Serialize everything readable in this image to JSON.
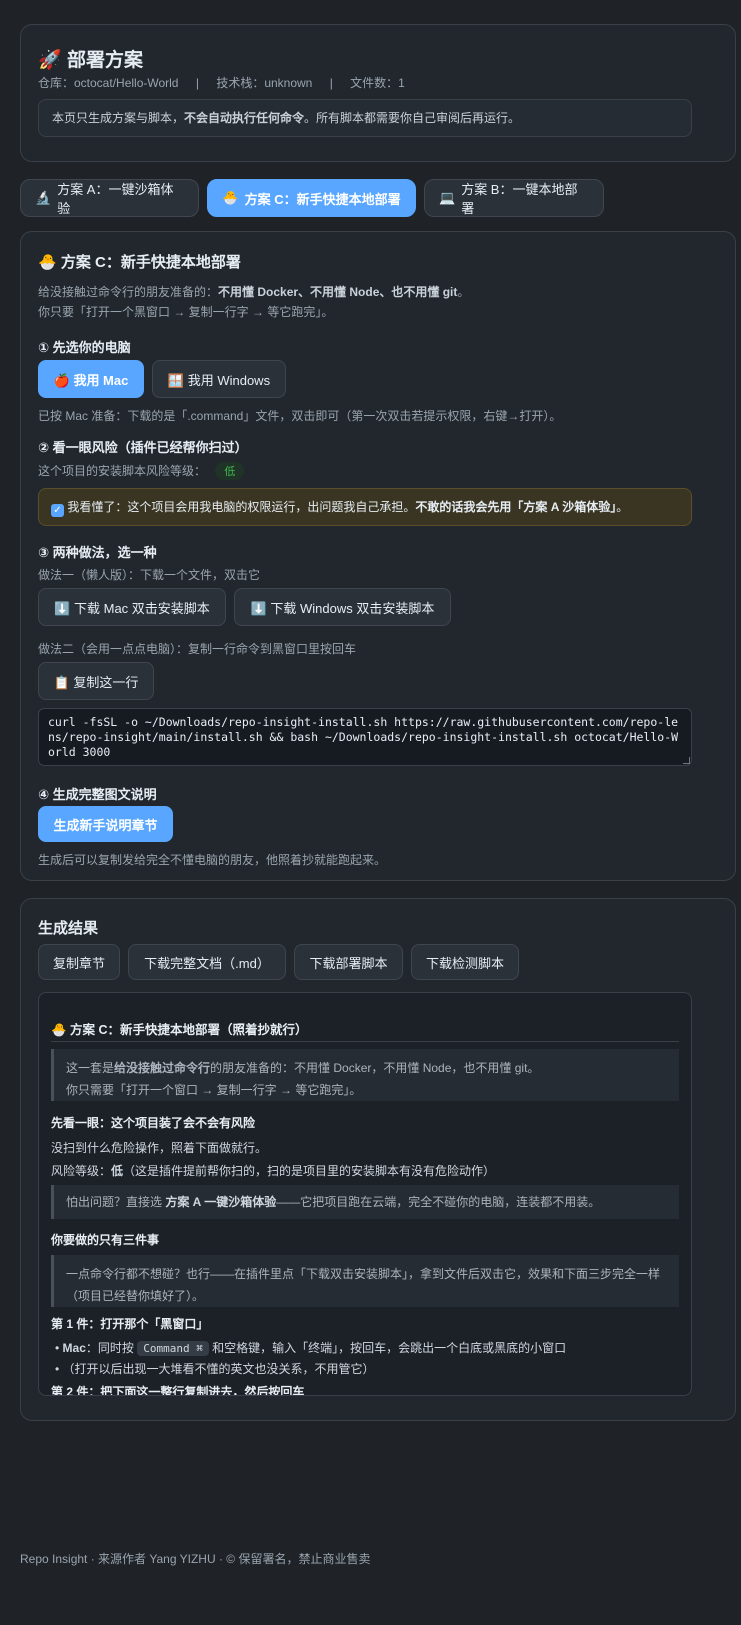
{
  "header": {
    "icon": "🚀",
    "title": "部署方案",
    "repo_label": "仓库：octocat/Hello-World",
    "sep1": "|",
    "stack_label": "技术栈：unknown",
    "sep2": "|",
    "files_label": "文件数：1",
    "notice_pre": "本页只生成方案与脚本，",
    "notice_bold": "不会自动执行任何命令",
    "notice_post": "。所有脚本都需要你自己审阅后再运行。"
  },
  "tabs": [
    {
      "icon": "🔬",
      "label": "方案 A：一键沙箱体验"
    },
    {
      "icon": "🐣",
      "label": "方案 C：新手快捷本地部署"
    },
    {
      "icon": "💻",
      "label": "方案 B：一键本地部署"
    }
  ],
  "plan": {
    "icon": "🐣",
    "title": "方案 C：新手快捷本地部署",
    "intro1_pre": "给没接触过命令行的朋友准备的：",
    "intro1_bold": "不用懂 Docker、不用懂 Node、也不用懂 git",
    "intro1_post": "。",
    "intro2": "你只要「打开一个黑窗口 → 复制一行字 → 等它跑完」。",
    "step1_title": "① 先选你的电脑",
    "mac_btn": "🍎 我用 Mac",
    "win_btn": "🪟 我用 Windows",
    "mac_note": "已按 Mac 准备：下载的是「.command」文件，双击即可（第一次双击若提示权限，右键→打开）。",
    "step2_title": "② 看一眼风险（插件已经帮你扫过）",
    "risk_label": "这个项目的安装脚本风险等级：",
    "risk_value": "低",
    "ack_pre": "我看懂了：这个项目会用我电脑的权限运行，出问题我自己承担。",
    "ack_bold": "不敢的话我会先用「方案 A 沙箱体验」",
    "ack_post": "。",
    "step3_title": "③ 两种做法，选一种",
    "way1": "做法一（懒人版）：下载一个文件，双击它",
    "dl_mac": "⬇️ 下载 Mac 双击安装脚本",
    "dl_win": "⬇️ 下载 Windows 双击安装脚本",
    "way2": "做法二（会用一点点电脑）：复制一行命令到黑窗口里按回车",
    "copy_btn": "📋 复制这一行",
    "command": "curl -fsSL -o ~/Downloads/repo-insight-install.sh https://raw.githubusercontent.com/repo-lens/repo-insight/main/install.sh && bash ~/Downloads/repo-insight-install.sh octocat/Hello-World 3000",
    "step4_title": "④ 生成完整图文说明",
    "gen_btn": "生成新手说明章节",
    "gen_note": "生成后可以复制发给完全不懂电脑的朋友，他照着抄就能跑起来。"
  },
  "result": {
    "title": "生成结果",
    "buttons": [
      "复制章节",
      "下载完整文档（.md）",
      "下载部署脚本",
      "下载检测脚本"
    ],
    "doc": {
      "heading": "🐣 方案 C：新手快捷本地部署（照着抄就行）",
      "quote1_l1_pre": "这一套是",
      "quote1_l1_bold": "给没接触过命令行",
      "quote1_l1_post": "的朋友准备的：不用懂 Docker，不用懂 Node，也不用懂 git。",
      "quote1_l2": "你只需要「打开一个窗口 → 复制一行字 → 等它跑完」。",
      "sub1": "先看一眼：这个项目装了会不会有风险",
      "p1": "没扫到什么危险操作，照着下面做就行。",
      "p2_pre": "风险等级：",
      "p2_bold": "低",
      "p2_post": "（这是插件提前帮你扫的，扫的是项目里的安装脚本有没有危险动作）",
      "quote2_pre": "怕出问题？直接选 ",
      "quote2_bold": "方案 A 一键沙箱体验",
      "quote2_post": "——它把项目跑在云端，完全不碰你的电脑，连装都不用装。",
      "sub2": "你要做的只有三件事",
      "quote3": "一点命令行都不想碰？也行——在插件里点「下载双击安装脚本」，拿到文件后双击它，效果和下面三步完全一样（项目已经替你填好了）。",
      "sub3": "第 1 件：打开那个「黑窗口」",
      "li1_bold": "Mac",
      "li1_pre": "：同时按 ",
      "li1_kbd": "Command ⌘",
      "li1_post": " 和空格键，输入「终端」，按回车，会跳出一个白底或黑底的小窗口",
      "li2": "（打开以后出现一大堆看不懂的英文也没关系，不用管它）",
      "sub4": "第 2 件：把下面这一整行复制进去，然后按回车"
    }
  },
  "footer": {
    "text": "Repo Insight · 来源作者 Yang YIZHU · © 保留署名，禁止商业售卖"
  },
  "colors": {
    "accent": "#58a6ff",
    "background": "#1f2328",
    "card": "#22272e",
    "warning_bg": "#3a3522",
    "risk_green": "#3fb950"
  }
}
